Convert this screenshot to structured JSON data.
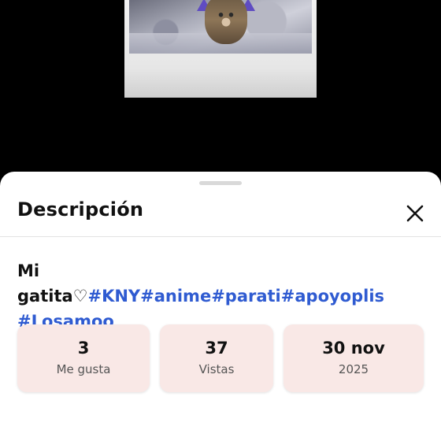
{
  "sheet": {
    "title": "Descripción",
    "close_icon": "close-icon"
  },
  "caption": {
    "text": "Mi gatita♡",
    "hashtags": [
      "#KNY",
      "#anime",
      "#parati",
      "#apoyoplis",
      "#Losamoo"
    ]
  },
  "stats": [
    {
      "value": "3",
      "label": "Me gusta"
    },
    {
      "value": "37",
      "label": "Vistas"
    },
    {
      "value": "30 nov",
      "label": "2025"
    }
  ],
  "colors": {
    "hashtag": "#2f5bd1",
    "stat_card": "#f9e8e6",
    "backdrop": "#000000"
  }
}
